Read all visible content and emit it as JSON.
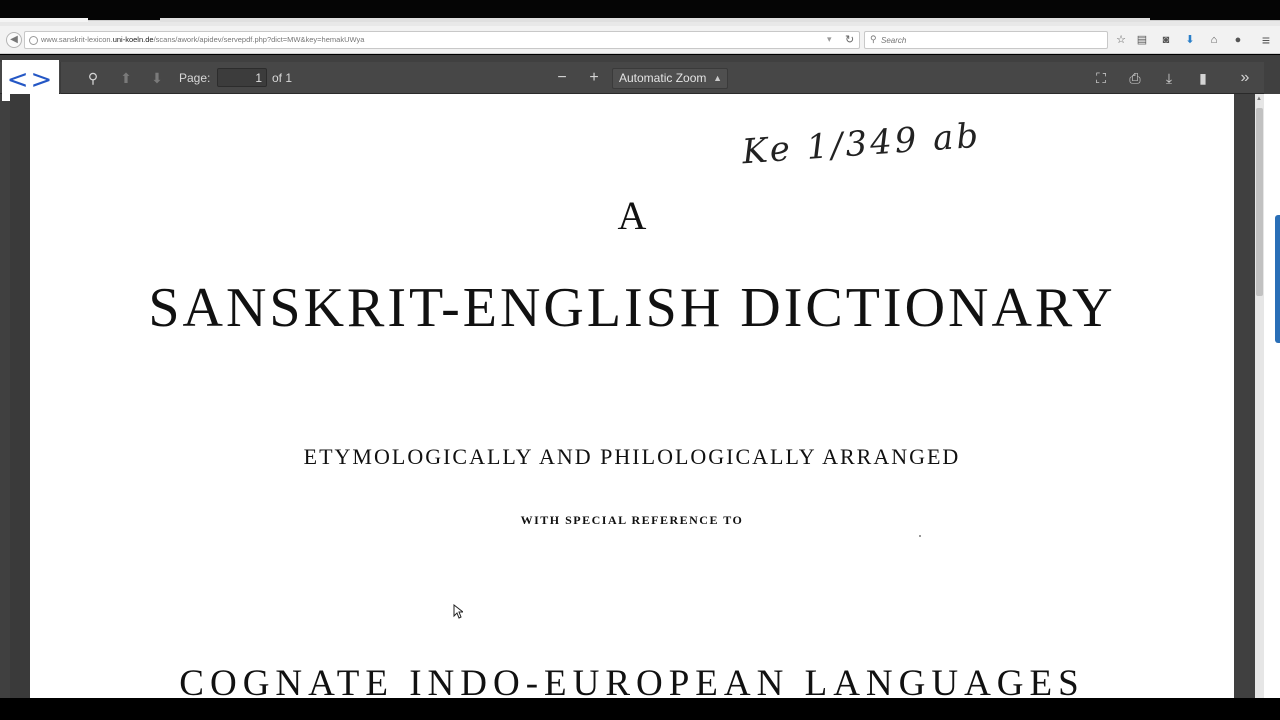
{
  "browser": {
    "url_prefix": "www.sanskrit-lexicon.",
    "url_host": "uni-koeln.de",
    "url_path": "/scans/awork/apidev/servepdf.php?dict=MW&key=hemakUWya",
    "search_placeholder": "Search"
  },
  "icons": {
    "back": "back-arrow-icon",
    "globe": "globe-icon",
    "reload": "reload-icon",
    "search": "search-icon",
    "bookmark": "star-icon",
    "reading_list": "clipboard-icon",
    "pocket": "pocket-icon",
    "download": "download-icon",
    "home": "home-icon",
    "chat": "chat-icon",
    "menu": "hamburger-menu-icon"
  },
  "pdf_toolbar": {
    "code_arrows": "<>",
    "page_label": "Page:",
    "page_value": "1",
    "page_of": "of 1",
    "zoom_label": "Automatic Zoom"
  },
  "document": {
    "handwriting": "Ke 1/349 ab",
    "line_a": "A",
    "title": "SANSKRIT-ENGLISH DICTIONARY",
    "subtitle_1": "ETYMOLOGICALLY AND PHILOLOGICALLY ARRANGED",
    "subtitle_2": "WITH SPECIAL REFERENCE TO",
    "subtitle_3": "COGNATE INDO-EUROPEAN LANGUAGES"
  },
  "colors": {
    "toolbar": "#474747",
    "viewer_bg": "#404040",
    "accent_blue": "#2457c5",
    "scroll_indicator": "#2a6fb7"
  }
}
